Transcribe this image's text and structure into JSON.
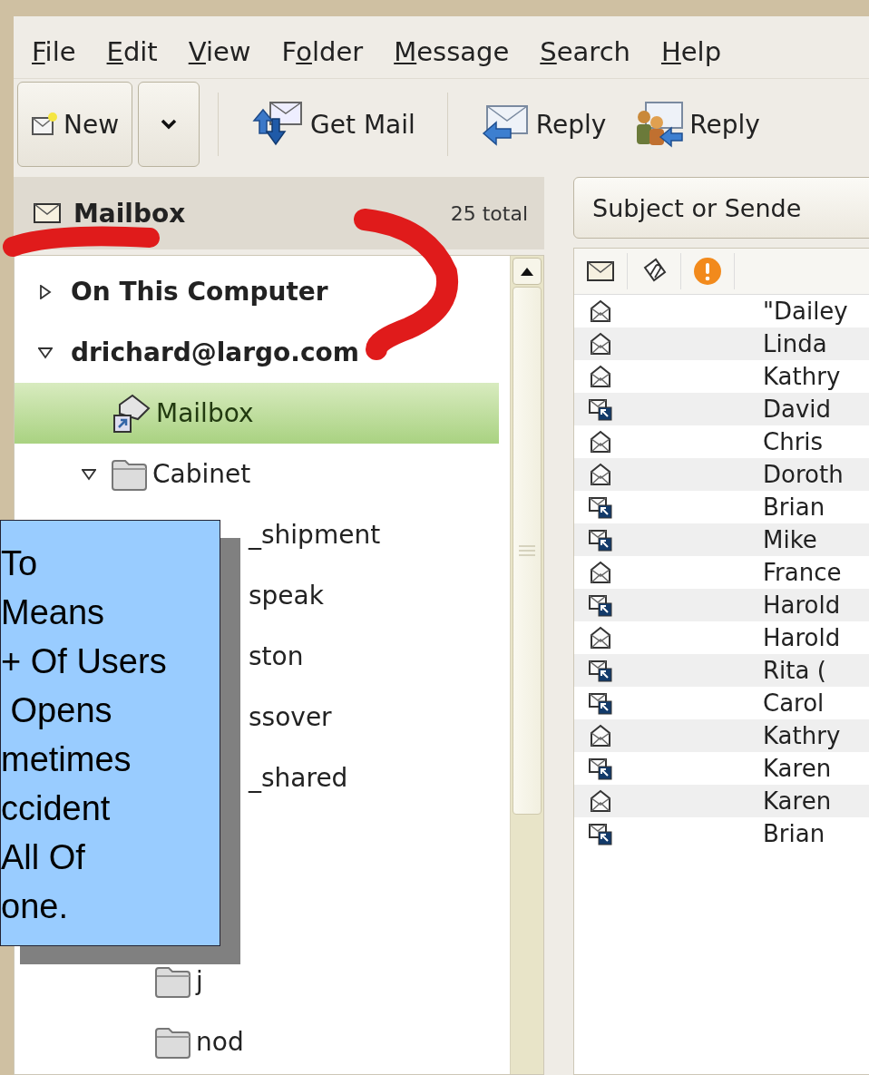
{
  "menu": [
    {
      "key": "F",
      "post": "ile"
    },
    {
      "key": "E",
      "post": "dit"
    },
    {
      "key": "V",
      "post": "iew"
    },
    {
      "pre": "F",
      "key": "o",
      "post": "lder"
    },
    {
      "key": "M",
      "post": "essage"
    },
    {
      "key": "S",
      "post": "earch"
    },
    {
      "key": "H",
      "post": "elp"
    }
  ],
  "toolbar": {
    "new_button": {
      "label": "New"
    },
    "buttons": [
      {
        "kind": "get-mail",
        "label": "Get Mail"
      },
      {
        "kind": "reply",
        "label": "Reply"
      },
      {
        "kind": "reply-group",
        "label": "Reply"
      }
    ]
  },
  "folder_pane": {
    "title": "Mailbox",
    "count": "25 total",
    "tree": [
      {
        "label": "On This Computer",
        "kind": "account",
        "expanded": false,
        "selected": false
      },
      {
        "label": "drichard@largo.com",
        "kind": "account",
        "expanded": true,
        "selected": false,
        "children": [
          {
            "label": "Mailbox",
            "kind": "inbox",
            "selected": true
          },
          {
            "label": "Cabinet",
            "kind": "folder",
            "expanded": true,
            "selected": false,
            "children": [
              {
                "label": "_shipment",
                "kind": "partial",
                "selected": false
              },
              {
                "label": "speak",
                "kind": "partial",
                "selected": false
              },
              {
                "label": "ston",
                "kind": "partial",
                "selected": false
              },
              {
                "label": "ssover",
                "kind": "partial",
                "selected": false
              },
              {
                "label": "_shared",
                "kind": "partial",
                "selected": false
              },
              {
                "label": "j",
                "kind": "folder",
                "selected": false
              },
              {
                "label": "nod",
                "kind": "folder",
                "selected": false
              }
            ]
          }
        ]
      }
    ]
  },
  "message_pane": {
    "search": {
      "value": "Subject or Sende"
    },
    "rows": [
      {
        "kind": "read",
        "sender": "\"Dailey"
      },
      {
        "kind": "read",
        "sender": "Linda"
      },
      {
        "kind": "read",
        "sender": "Kathry"
      },
      {
        "kind": "replied",
        "sender": "David"
      },
      {
        "kind": "read",
        "sender": "Chris"
      },
      {
        "kind": "read",
        "sender": "Doroth"
      },
      {
        "kind": "replied",
        "sender": "Brian"
      },
      {
        "kind": "replied",
        "sender": "Mike"
      },
      {
        "kind": "read",
        "sender": "France"
      },
      {
        "kind": "replied",
        "sender": "Harold"
      },
      {
        "kind": "read",
        "sender": "Harold"
      },
      {
        "kind": "replied",
        "sender": "Rita ("
      },
      {
        "kind": "replied",
        "sender": "Carol"
      },
      {
        "kind": "read",
        "sender": "Kathry"
      },
      {
        "kind": "replied",
        "sender": "Karen"
      },
      {
        "kind": "read",
        "sender": "Karen"
      },
      {
        "kind": "replied",
        "sender": "Brian"
      }
    ]
  },
  "callout": {
    "lines": [
      "To",
      "Means",
      "+ Of Users",
      " Opens",
      "metimes",
      "ccident",
      "All Of",
      "one."
    ]
  }
}
